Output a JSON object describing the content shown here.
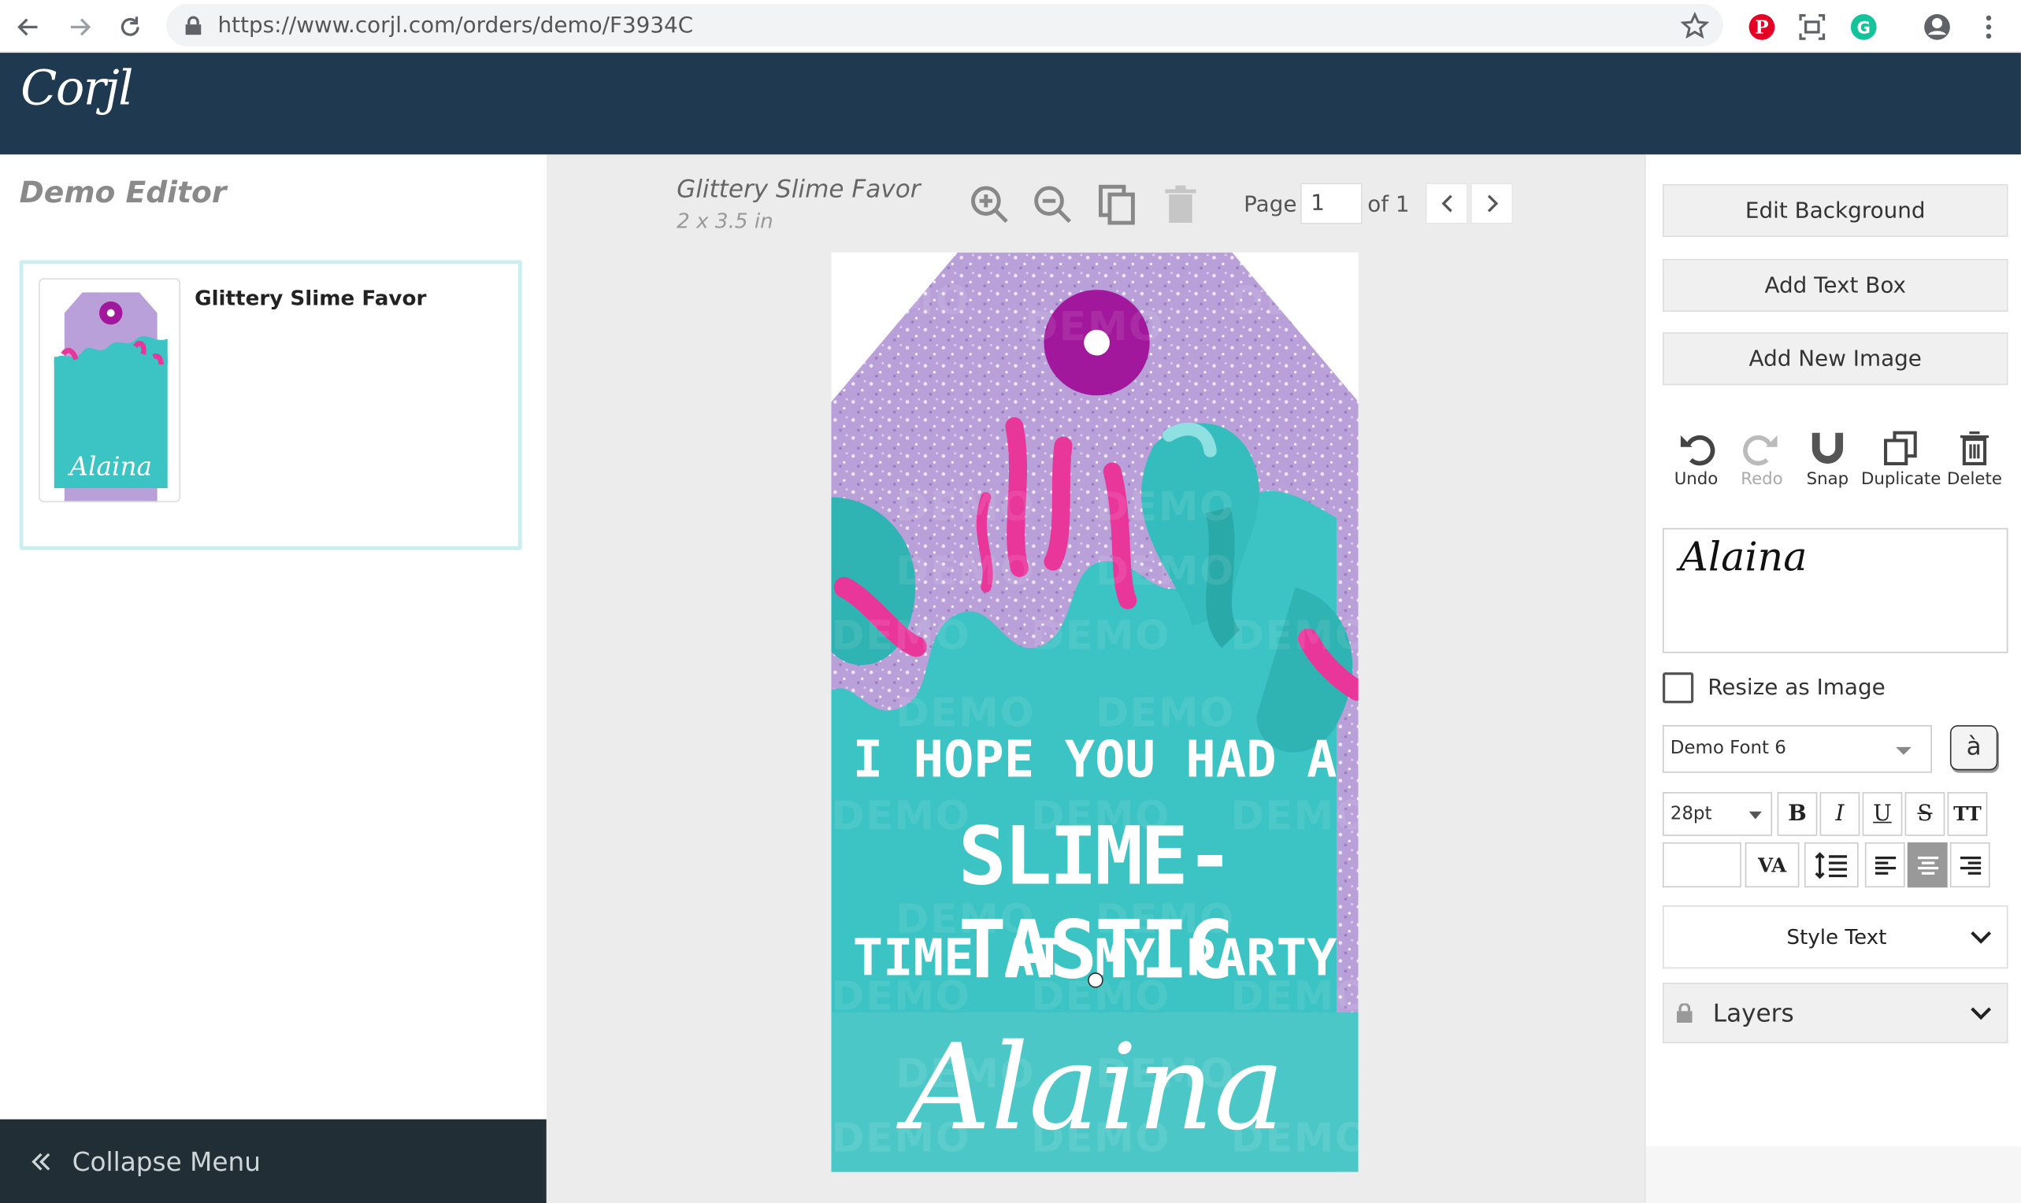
{
  "browser": {
    "url": "https://www.corjl.com/orders/demo/F3934C",
    "icons": [
      "back-arrow-icon",
      "forward-arrow-icon",
      "reload-icon",
      "lock-icon",
      "star-icon",
      "pinterest-icon",
      "screenshot-icon",
      "grammarly-icon",
      "account-icon",
      "menu-icon"
    ]
  },
  "header": {
    "logo": "Corjl"
  },
  "left": {
    "title": "Demo Editor",
    "card_name": "Glittery Slime Favor",
    "thumb_name": "Alaina",
    "collapse_label": "Collapse Menu"
  },
  "center": {
    "doc_title": "Glittery Slime Favor",
    "doc_size": "2 x 3.5 in",
    "page_label": "Page",
    "page_value": "1",
    "page_of": "of 1",
    "watermark": "DEMO",
    "tag": {
      "line1": "I HOPE YOU HAD A",
      "line2": "SLIME-TASTIC",
      "line3": "TIME AT MY PARTY",
      "name": "Alaina"
    }
  },
  "right": {
    "edit_background": "Edit Background",
    "add_text_box": "Add Text Box",
    "add_new_image": "Add New Image",
    "actions": {
      "undo": "Undo",
      "redo": "Redo",
      "snap": "Snap",
      "duplicate": "Duplicate",
      "delete": "Delete"
    },
    "text_value": "Alaina",
    "resize_label": "Resize as Image",
    "font": "Demo Font 6",
    "glyph": "à",
    "font_size": "28pt",
    "format": {
      "bold": "B",
      "italic": "I",
      "underline": "U",
      "strike": "S",
      "caps": "TT",
      "tracking": "VA"
    },
    "style_text": "Style Text",
    "layers": "Layers"
  },
  "colors": {
    "header": "#1f3a50",
    "teal": "#3cc3c3",
    "glitter": "#b9a0d9",
    "pink": "#e8369b",
    "purple": "#a2189c"
  }
}
